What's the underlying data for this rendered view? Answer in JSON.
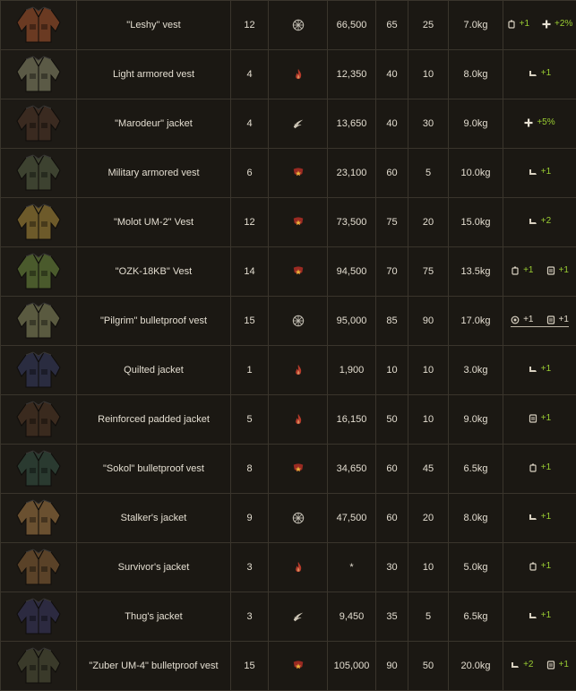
{
  "rows": [
    {
      "name": "\"Leshy\" vest",
      "rank": "12",
      "faction_icon": "wheel-icon",
      "price": "66,500",
      "rupture": "65",
      "radiation": "25",
      "weight": "7.0kg",
      "color": "#6a3a22",
      "bonuses": [
        {
          "icon": "battery-icon",
          "value": "+1"
        },
        {
          "icon": "health-plus-icon",
          "value": "+2%"
        }
      ]
    },
    {
      "name": "Light armored vest",
      "rank": "4",
      "faction_icon": "fire-icon",
      "price": "12,350",
      "rupture": "40",
      "radiation": "10",
      "weight": "8.0kg",
      "color": "#5b5a46",
      "bonuses": [
        {
          "icon": "shoe-icon",
          "value": "+1"
        }
      ]
    },
    {
      "name": "\"Marodeur\" jacket",
      "rank": "4",
      "faction_icon": "claw-icon",
      "price": "13,650",
      "rupture": "40",
      "radiation": "30",
      "weight": "9.0kg",
      "color": "#3a2a20",
      "bonuses": [
        {
          "icon": "health-plus-icon",
          "value": "+5%"
        }
      ]
    },
    {
      "name": "Military armored vest",
      "rank": "6",
      "faction_icon": "star-badge-icon",
      "price": "23,100",
      "rupture": "60",
      "radiation": "5",
      "weight": "10.0kg",
      "color": "#3d4230",
      "bonuses": [
        {
          "icon": "shoe-icon",
          "value": "+1"
        }
      ]
    },
    {
      "name": "\"Molot UM-2\" Vest",
      "rank": "12",
      "faction_icon": "star-badge-icon",
      "price": "73,500",
      "rupture": "75",
      "radiation": "20",
      "weight": "15.0kg",
      "color": "#6d5a2a",
      "bonuses": [
        {
          "icon": "shoe-icon",
          "value": "+2"
        }
      ]
    },
    {
      "name": "\"OZK-18KB\" Vest",
      "rank": "14",
      "faction_icon": "star-badge-icon",
      "price": "94,500",
      "rupture": "70",
      "radiation": "75",
      "weight": "13.5kg",
      "color": "#4a5a2c",
      "bonuses": [
        {
          "icon": "battery-icon",
          "value": "+1"
        },
        {
          "icon": "container-icon",
          "value": "+1"
        }
      ]
    },
    {
      "name": "\"Pilgrim\" bulletproof vest",
      "rank": "15",
      "faction_icon": "wheel-icon",
      "price": "95,000",
      "rupture": "85",
      "radiation": "90",
      "weight": "17.0kg",
      "color": "#5a5a40",
      "bonuses": [
        {
          "icon": "target-icon",
          "value": "+1",
          "white": true
        },
        {
          "icon": "container-icon",
          "value": "+1",
          "white": true
        }
      ],
      "underline": true
    },
    {
      "name": "Quilted jacket",
      "rank": "1",
      "faction_icon": "fire-icon",
      "price": "1,900",
      "rupture": "10",
      "radiation": "10",
      "weight": "3.0kg",
      "color": "#2a2c40",
      "bonuses": [
        {
          "icon": "shoe-icon",
          "value": "+1"
        }
      ]
    },
    {
      "name": "Reinforced padded jacket",
      "rank": "5",
      "faction_icon": "fire-icon",
      "price": "16,150",
      "rupture": "50",
      "radiation": "10",
      "weight": "9.0kg",
      "color": "#3a2a1e",
      "bonuses": [
        {
          "icon": "container-icon",
          "value": "+1"
        }
      ]
    },
    {
      "name": "\"Sokol\" bulletproof vest",
      "rank": "8",
      "faction_icon": "star-badge-icon",
      "price": "34,650",
      "rupture": "60",
      "radiation": "45",
      "weight": "6.5kg",
      "color": "#2a3a30",
      "bonuses": [
        {
          "icon": "battery-icon",
          "value": "+1"
        }
      ]
    },
    {
      "name": "Stalker's jacket",
      "rank": "9",
      "faction_icon": "wheel-icon",
      "price": "47,500",
      "rupture": "60",
      "radiation": "20",
      "weight": "8.0kg",
      "color": "#6a5030",
      "bonuses": [
        {
          "icon": "shoe-icon",
          "value": "+1"
        }
      ]
    },
    {
      "name": "Survivor's jacket",
      "rank": "3",
      "faction_icon": "fire-icon",
      "price": "*",
      "rupture": "30",
      "radiation": "10",
      "weight": "5.0kg",
      "color": "#5a4228",
      "bonuses": [
        {
          "icon": "battery-icon",
          "value": "+1"
        }
      ]
    },
    {
      "name": "Thug's jacket",
      "rank": "3",
      "faction_icon": "claw-icon",
      "price": "9,450",
      "rupture": "35",
      "radiation": "5",
      "weight": "6.5kg",
      "color": "#2c2a40",
      "bonuses": [
        {
          "icon": "shoe-icon",
          "value": "+1"
        }
      ]
    },
    {
      "name": "\"Zuber UM-4\" bulletproof vest",
      "rank": "15",
      "faction_icon": "star-badge-icon",
      "price": "105,000",
      "rupture": "90",
      "radiation": "50",
      "weight": "20.0kg",
      "color": "#3a3a2a",
      "bonuses": [
        {
          "icon": "shoe-icon",
          "value": "+2"
        },
        {
          "icon": "container-icon",
          "value": "+1"
        }
      ]
    }
  ]
}
